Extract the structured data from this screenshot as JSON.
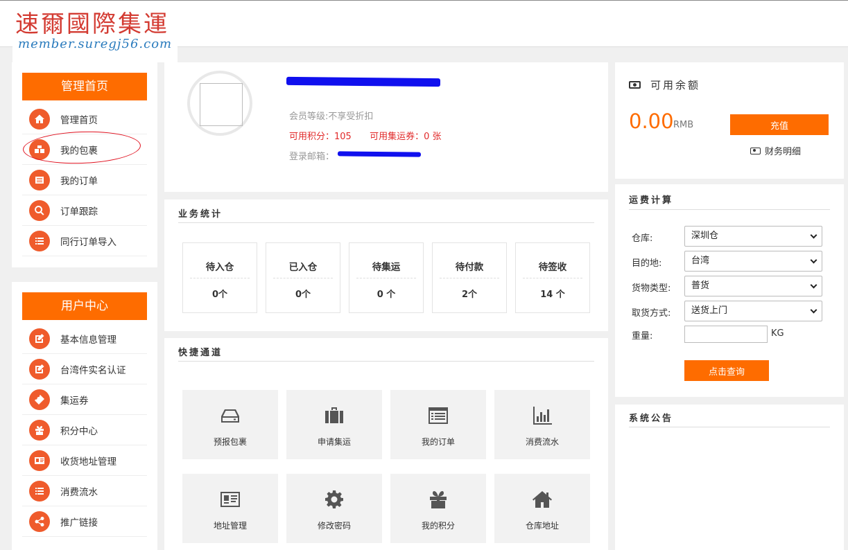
{
  "header": {
    "logo_text": "速爾國際集運",
    "logo_url": "member.suregj56.com"
  },
  "sidebar": {
    "admin_title": "管理首页",
    "admin_items": [
      {
        "label": "管理首页",
        "icon": "home-icon"
      },
      {
        "label": "我的包裹",
        "icon": "packages-icon"
      },
      {
        "label": "我的订单",
        "icon": "order-list-icon"
      },
      {
        "label": "订单跟踪",
        "icon": "search-icon"
      },
      {
        "label": "同行订单导入",
        "icon": "list-icon"
      }
    ],
    "user_title": "用户中心",
    "user_items": [
      {
        "label": "基本信息管理",
        "icon": "edit-icon"
      },
      {
        "label": "台湾件实名认证",
        "icon": "edit-icon"
      },
      {
        "label": "集运券",
        "icon": "ticket-icon"
      },
      {
        "label": "积分中心",
        "icon": "gift-icon"
      },
      {
        "label": "收货地址管理",
        "icon": "address-card-icon"
      },
      {
        "label": "消费流水",
        "icon": "list-icon"
      },
      {
        "label": "推广链接",
        "icon": "share-icon"
      }
    ]
  },
  "profile": {
    "level": "会员等级:不享受折扣",
    "points_label": "可用积分：",
    "points_value": "105",
    "coupons_label": "可用集运券：",
    "coupons_value": "0 张",
    "email_label": "登录邮箱："
  },
  "stats": {
    "title": "业务统计",
    "items": [
      {
        "label": "待入仓",
        "value": "0个"
      },
      {
        "label": "已入仓",
        "value": "0个"
      },
      {
        "label": "待集运",
        "value": "0 个"
      },
      {
        "label": "待付款",
        "value": "2个"
      },
      {
        "label": "待签收",
        "value": "14 个"
      }
    ]
  },
  "quick": {
    "title": "快捷通道",
    "items": [
      {
        "label": "预报包裹",
        "icon": "inbox-icon"
      },
      {
        "label": "申请集运",
        "icon": "briefcase-icon"
      },
      {
        "label": "我的订单",
        "icon": "list-window-icon"
      },
      {
        "label": "消费流水",
        "icon": "bar-chart-icon"
      },
      {
        "label": "地址管理",
        "icon": "address-card-icon"
      },
      {
        "label": "修改密码",
        "icon": "gear-icon"
      },
      {
        "label": "我的积分",
        "icon": "gift-icon"
      },
      {
        "label": "仓库地址",
        "icon": "home-icon"
      }
    ]
  },
  "balance": {
    "title": "可用余额",
    "amount": "0.00",
    "unit": "RMB",
    "recharge_label": "充值",
    "details_label": "财务明细"
  },
  "freight": {
    "title": "运费计算",
    "warehouse_label": "仓库:",
    "warehouse_value": "深圳仓",
    "destination_label": "目的地:",
    "destination_value": "台湾",
    "cargo_label": "货物类型:",
    "cargo_value": "普货",
    "pickup_label": "取货方式:",
    "pickup_value": "送货上门",
    "weight_label": "重量:",
    "weight_unit": "KG",
    "query_label": "点击查询"
  },
  "notice": {
    "title": "系统公告"
  },
  "colors": {
    "accent": "#fe6c00",
    "icon_circle": "#ef5b2c",
    "logo_red": "#d33b32",
    "url_blue": "#2a7bbd",
    "highlight_red": "#e12a2a"
  }
}
